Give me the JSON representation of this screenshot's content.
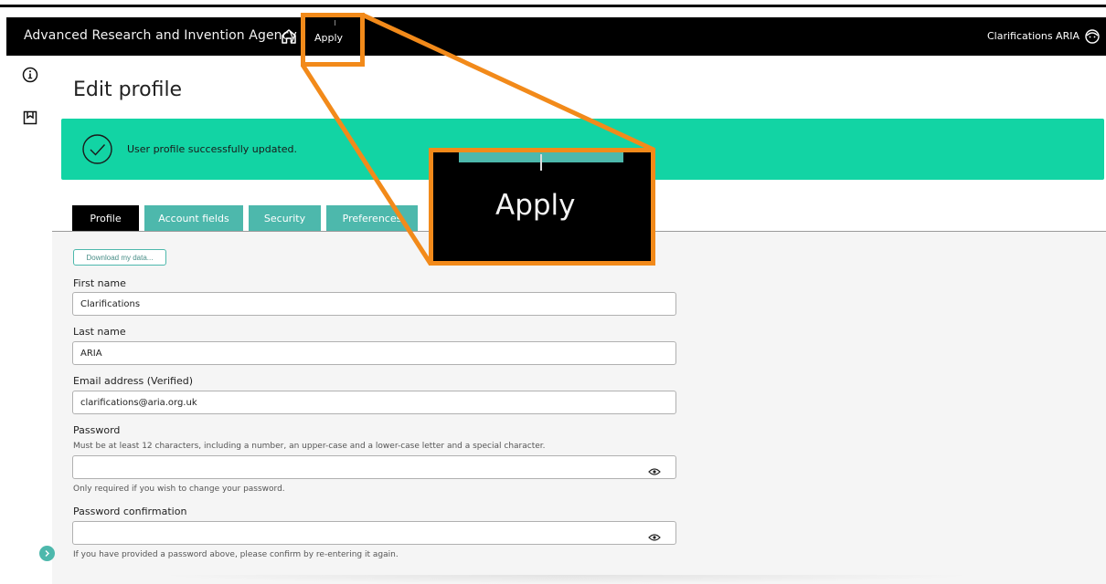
{
  "header": {
    "brand": "Advanced Research and Invention Agency",
    "nav_apply": "Apply",
    "user_name": "Clarifications ARIA"
  },
  "sidebar": {
    "icons": [
      "info-icon",
      "bookmark-icon"
    ]
  },
  "page": {
    "title": "Edit profile"
  },
  "banner": {
    "message": "User profile successfully updated."
  },
  "tabs": [
    {
      "label": "Profile",
      "active": true
    },
    {
      "label": "Account fields",
      "active": false
    },
    {
      "label": "Security",
      "active": false
    },
    {
      "label": "Preferences",
      "active": false
    }
  ],
  "form": {
    "download_label": "Download my data...",
    "first_name_label": "First name",
    "first_name_value": "Clarifications",
    "last_name_label": "Last name",
    "last_name_value": "ARIA",
    "email_label": "Email address (Verified)",
    "email_value": "clarifications@aria.org.uk",
    "password_label": "Password",
    "password_hint": "Must be at least 12 characters, including a number, an upper-case and a lower-case letter and a special character.",
    "password_value": "",
    "password_note": "Only required if you wish to change your password.",
    "password_confirm_label": "Password confirmation",
    "password_confirm_value": "",
    "password_confirm_note": "If you have provided a password above, please confirm by re-entering it again."
  },
  "callout": {
    "zoom_label": "Apply"
  },
  "colors": {
    "accent_teal": "#4db8ac",
    "success_green": "#12d4a4",
    "callout_orange": "#f28a1a",
    "header_black": "#000000"
  }
}
